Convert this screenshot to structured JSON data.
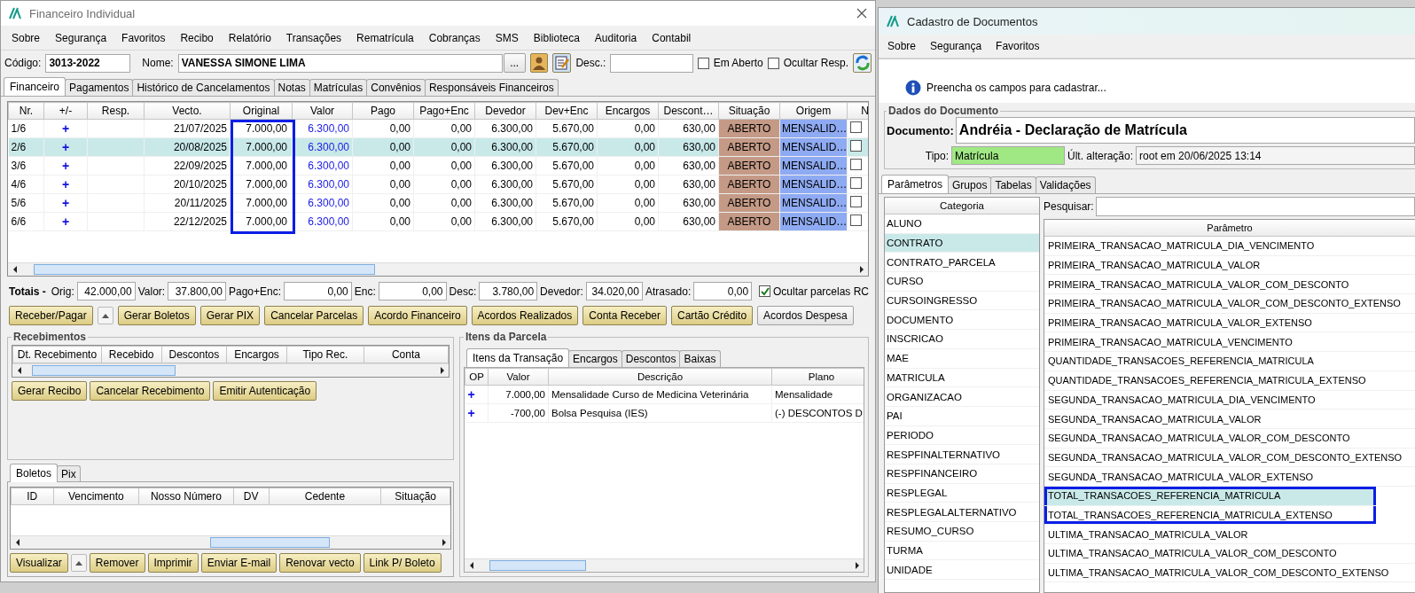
{
  "financeiro": {
    "title": "Financeiro Individual",
    "menu": [
      "Sobre",
      "Segurança",
      "Favoritos",
      "Recibo",
      "Relatório",
      "Transações",
      "Rematrícula",
      "Cobranças",
      "SMS",
      "Biblioteca",
      "Auditoria",
      "Contabil"
    ],
    "codigo": {
      "label": "Código:",
      "value": "3013-2022"
    },
    "nome": {
      "label": "Nome:",
      "value": "VANESSA SIMONE LIMA"
    },
    "browse_button": "...",
    "desc": {
      "label": "Desc.:"
    },
    "options": [
      {
        "label": "Em Aberto",
        "checked": false
      },
      {
        "label": "Ocultar Resp.",
        "checked": false
      }
    ],
    "tabs": [
      {
        "label": "Financeiro",
        "selected": true
      },
      {
        "label": "Pagamentos",
        "selected": false
      },
      {
        "label": "Histórico de Cancelamentos",
        "selected": false
      },
      {
        "label": "Notas",
        "selected": false
      },
      {
        "label": "Matrículas",
        "selected": false
      },
      {
        "label": "Convênios",
        "selected": false
      },
      {
        "label": "Responsáveis Financeiros",
        "selected": false
      }
    ],
    "grid": {
      "columns": [
        {
          "label": "Nr.",
          "highlighted": false
        },
        {
          "label": "+/-",
          "highlighted": false
        },
        {
          "label": "Resp.",
          "highlighted": false
        },
        {
          "label": "Vecto.",
          "highlighted": false
        },
        {
          "label": "Original",
          "highlighted": true
        },
        {
          "label": "Valor",
          "highlighted": false
        },
        {
          "label": "Pago",
          "highlighted": false
        },
        {
          "label": "Pago+Enc",
          "highlighted": false
        },
        {
          "label": "Devedor",
          "highlighted": false
        },
        {
          "label": "Dev+Enc",
          "highlighted": false
        },
        {
          "label": "Encargos",
          "highlighted": false
        },
        {
          "label": "Descont…",
          "highlighted": false
        },
        {
          "label": "Situação",
          "highlighted": false
        },
        {
          "label": "Origem",
          "highlighted": false
        },
        {
          "label": "N",
          "highlighted": false
        }
      ],
      "rows": [
        {
          "nr": "1/6",
          "op": "+",
          "vecto": "21/07/2025",
          "original": "7.000,00",
          "valor": "6.300,00",
          "pago": "0,00",
          "pago_enc": "0,00",
          "devedor": "6.300,00",
          "dev_enc": "5.670,00",
          "encargos": "0,00",
          "descontos": "630,00",
          "situacao": "ABERTO",
          "origem": "MENSALID…",
          "nf_checked": false,
          "selected": false
        },
        {
          "nr": "2/6",
          "op": "+",
          "vecto": "20/08/2025",
          "original": "7.000,00",
          "valor": "6.300,00",
          "pago": "0,00",
          "pago_enc": "0,00",
          "devedor": "6.300,00",
          "dev_enc": "5.670,00",
          "encargos": "0,00",
          "descontos": "630,00",
          "situacao": "ABERTO",
          "origem": "MENSALID…",
          "nf_checked": false,
          "selected": true
        },
        {
          "nr": "3/6",
          "op": "+",
          "vecto": "22/09/2025",
          "original": "7.000,00",
          "valor": "6.300,00",
          "pago": "0,00",
          "pago_enc": "0,00",
          "devedor": "6.300,00",
          "dev_enc": "5.670,00",
          "encargos": "0,00",
          "descontos": "630,00",
          "situacao": "ABERTO",
          "origem": "MENSALID…",
          "nf_checked": false,
          "selected": false
        },
        {
          "nr": "4/6",
          "op": "+",
          "vecto": "20/10/2025",
          "original": "7.000,00",
          "valor": "6.300,00",
          "pago": "0,00",
          "pago_enc": "0,00",
          "devedor": "6.300,00",
          "dev_enc": "5.670,00",
          "encargos": "0,00",
          "descontos": "630,00",
          "situacao": "ABERTO",
          "origem": "MENSALID…",
          "nf_checked": false,
          "selected": false
        },
        {
          "nr": "5/6",
          "op": "+",
          "vecto": "20/11/2025",
          "original": "7.000,00",
          "valor": "6.300,00",
          "pago": "0,00",
          "pago_enc": "0,00",
          "devedor": "6.300,00",
          "dev_enc": "5.670,00",
          "encargos": "0,00",
          "descontos": "630,00",
          "situacao": "ABERTO",
          "origem": "MENSALID…",
          "nf_checked": false,
          "selected": false
        },
        {
          "nr": "6/6",
          "op": "+",
          "vecto": "22/12/2025",
          "original": "7.000,00",
          "valor": "6.300,00",
          "pago": "0,00",
          "pago_enc": "0,00",
          "devedor": "6.300,00",
          "dev_enc": "5.670,00",
          "encargos": "0,00",
          "descontos": "630,00",
          "situacao": "ABERTO",
          "origem": "MENSALID…",
          "nf_checked": false,
          "selected": false
        }
      ]
    },
    "totals": {
      "label": "Totais -",
      "fields": [
        {
          "label": "Orig:",
          "value": "42.000,00"
        },
        {
          "label": "Valor:",
          "value": "37.800,00"
        },
        {
          "label": "Pago+Enc:",
          "value": "0,00"
        },
        {
          "label": "Enc:",
          "value": "0,00"
        },
        {
          "label": "Desc:",
          "value": "3.780,00"
        },
        {
          "label": "Devedor:",
          "value": "34.020,00"
        },
        {
          "label": "Atrasado:",
          "value": "0,00"
        }
      ],
      "option": {
        "label": "Ocultar parcelas RC",
        "checked": true
      }
    },
    "actions": [
      {
        "kind": "highlighted",
        "label": "Receber/Pagar"
      },
      {
        "kind": "dropdown"
      },
      {
        "kind": "highlighted",
        "label": "Gerar Boletos"
      },
      {
        "kind": "highlighted",
        "label": "Gerar PIX"
      },
      {
        "kind": "highlighted",
        "label": "Cancelar Parcelas"
      },
      {
        "kind": "highlighted",
        "label": "Acordo Financeiro"
      },
      {
        "kind": "highlighted",
        "label": "Acordos Realizados"
      },
      {
        "kind": "highlighted",
        "label": "Conta Receber"
      },
      {
        "kind": "highlighted",
        "label": "Cartão Crédito"
      },
      {
        "kind": "standard",
        "label": "Acordos Despesa"
      }
    ],
    "recebimentos": {
      "title": "Recebimentos",
      "columns": [
        "Dt. Recebimento",
        "Recebido",
        "Descontos",
        "Encargos",
        "Tipo Rec.",
        "Conta"
      ],
      "buttons": [
        {
          "kind": "highlighted",
          "label": "Gerar Recibo"
        },
        {
          "kind": "highlighted",
          "label": "Cancelar Recebimento"
        },
        {
          "kind": "highlighted",
          "label": "Emitir Autenticação"
        }
      ]
    },
    "boletos": {
      "tabs": [
        {
          "label": "Boletos",
          "selected": true
        },
        {
          "label": "Pix",
          "selected": false
        }
      ],
      "columns": [
        "ID",
        "Vencimento",
        "Nosso Número",
        "DV",
        "Cedente",
        "Situação"
      ],
      "buttons": [
        {
          "kind": "highlighted",
          "label": "Visualizar"
        },
        {
          "kind": "dropdown"
        },
        {
          "kind": "highlighted",
          "label": "Remover"
        },
        {
          "kind": "highlighted",
          "label": "Imprimir"
        },
        {
          "kind": "highlighted",
          "label": "Enviar E-mail"
        },
        {
          "kind": "highlighted",
          "label": "Renovar vecto"
        },
        {
          "kind": "highlighted",
          "label": "Link P/ Boleto"
        }
      ]
    },
    "itens": {
      "title": "Itens da Parcela",
      "tabs": [
        {
          "label": "Itens da Transação",
          "selected": true
        },
        {
          "label": "Encargos",
          "selected": false
        },
        {
          "label": "Descontos",
          "selected": false
        },
        {
          "label": "Baixas",
          "selected": false
        }
      ],
      "columns": [
        "OP",
        "Valor",
        "Descrição",
        "Plano"
      ],
      "rows": [
        {
          "op": "+",
          "valor": "7.000,00",
          "descricao": "Mensalidade Curso de Medicina Veterinária",
          "plano": "Mensalidade"
        },
        {
          "op": "+",
          "valor": "-700,00",
          "descricao": "Bolsa Pesquisa (IES)",
          "plano": "(-) DESCONTOS D"
        }
      ]
    }
  },
  "cadastro": {
    "title": "Cadastro de Documentos",
    "menu": [
      "Sobre",
      "Segurança",
      "Favoritos"
    ],
    "info": "Preencha os campos para cadastrar...",
    "group": "Dados do Documento",
    "documento": {
      "label": "Documento:",
      "value": "Andréia - Declaração de Matrícula"
    },
    "tipo": {
      "label": "Tipo:",
      "value": "Matrícula"
    },
    "alteracao": {
      "label": "Últ. alteração:",
      "value": "root em 20/06/2025 13:14"
    },
    "tabs": [
      {
        "label": "Parâmetros",
        "selected": true
      },
      {
        "label": "Grupos",
        "selected": false
      },
      {
        "label": "Tabelas",
        "selected": false
      },
      {
        "label": "Validações",
        "selected": false
      }
    ],
    "categorias": {
      "header": "Categoria",
      "items": [
        {
          "label": "ALUNO",
          "selected": false
        },
        {
          "label": "CONTRATO",
          "selected": true
        },
        {
          "label": "CONTRATO_PARCELA",
          "selected": false
        },
        {
          "label": "CURSO",
          "selected": false
        },
        {
          "label": "CURSOINGRESSO",
          "selected": false
        },
        {
          "label": "DOCUMENTO",
          "selected": false
        },
        {
          "label": "INSCRICAO",
          "selected": false
        },
        {
          "label": "MAE",
          "selected": false
        },
        {
          "label": "MATRICULA",
          "selected": false
        },
        {
          "label": "ORGANIZACAO",
          "selected": false
        },
        {
          "label": "PAI",
          "selected": false
        },
        {
          "label": "PERIODO",
          "selected": false
        },
        {
          "label": "RESPFINALTERNATIVO",
          "selected": false
        },
        {
          "label": "RESPFINANCEIRO",
          "selected": false
        },
        {
          "label": "RESPLEGAL",
          "selected": false
        },
        {
          "label": "RESPLEGALALTERNATIVO",
          "selected": false
        },
        {
          "label": "RESUMO_CURSO",
          "selected": false
        },
        {
          "label": "TURMA",
          "selected": false
        },
        {
          "label": "UNIDADE",
          "selected": false
        }
      ]
    },
    "search": {
      "label": "Pesquisar:"
    },
    "parametros": {
      "header": "Parâmetro",
      "rows": [
        {
          "label": "PRIMEIRA_TRANSACAO_MATRICULA_DIA_VENCIMENTO",
          "selected": false,
          "highlighted": false
        },
        {
          "label": "PRIMEIRA_TRANSACAO_MATRICULA_VALOR",
          "selected": false,
          "highlighted": false
        },
        {
          "label": "PRIMEIRA_TRANSACAO_MATRICULA_VALOR_COM_DESCONTO",
          "selected": false,
          "highlighted": false
        },
        {
          "label": "PRIMEIRA_TRANSACAO_MATRICULA_VALOR_COM_DESCONTO_EXTENSO",
          "selected": false,
          "highlighted": false
        },
        {
          "label": "PRIMEIRA_TRANSACAO_MATRICULA_VALOR_EXTENSO",
          "selected": false,
          "highlighted": false
        },
        {
          "label": "PRIMEIRA_TRANSACAO_MATRICULA_VENCIMENTO",
          "selected": false,
          "highlighted": false
        },
        {
          "label": "QUANTIDADE_TRANSACOES_REFERENCIA_MATRICULA",
          "selected": false,
          "highlighted": false
        },
        {
          "label": "QUANTIDADE_TRANSACOES_REFERENCIA_MATRICULA_EXTENSO",
          "selected": false,
          "highlighted": false
        },
        {
          "label": "SEGUNDA_TRANSACAO_MATRICULA_DIA_VENCIMENTO",
          "selected": false,
          "highlighted": false
        },
        {
          "label": "SEGUNDA_TRANSACAO_MATRICULA_VALOR",
          "selected": false,
          "highlighted": false
        },
        {
          "label": "SEGUNDA_TRANSACAO_MATRICULA_VALOR_COM_DESCONTO",
          "selected": false,
          "highlighted": false
        },
        {
          "label": "SEGUNDA_TRANSACAO_MATRICULA_VALOR_COM_DESCONTO_EXTENSO",
          "selected": false,
          "highlighted": false
        },
        {
          "label": "SEGUNDA_TRANSACAO_MATRICULA_VALOR_EXTENSO",
          "selected": false,
          "highlighted": false
        },
        {
          "label": "TOTAL_TRANSACOES_REFERENCIA_MATRICULA",
          "selected": true,
          "highlighted": true
        },
        {
          "label": "TOTAL_TRANSACOES_REFERENCIA_MATRICULA_EXTENSO",
          "selected": false,
          "highlighted": true
        },
        {
          "label": "ULTIMA_TRANSACAO_MATRICULA_VALOR",
          "selected": false,
          "highlighted": false
        },
        {
          "label": "ULTIMA_TRANSACAO_MATRICULA_VALOR_COM_DESCONTO",
          "selected": false,
          "highlighted": false
        },
        {
          "label": "ULTIMA_TRANSACAO_MATRICULA_VALOR_COM_DESCONTO_EXTENSO",
          "selected": false,
          "highlighted": false
        }
      ]
    }
  }
}
